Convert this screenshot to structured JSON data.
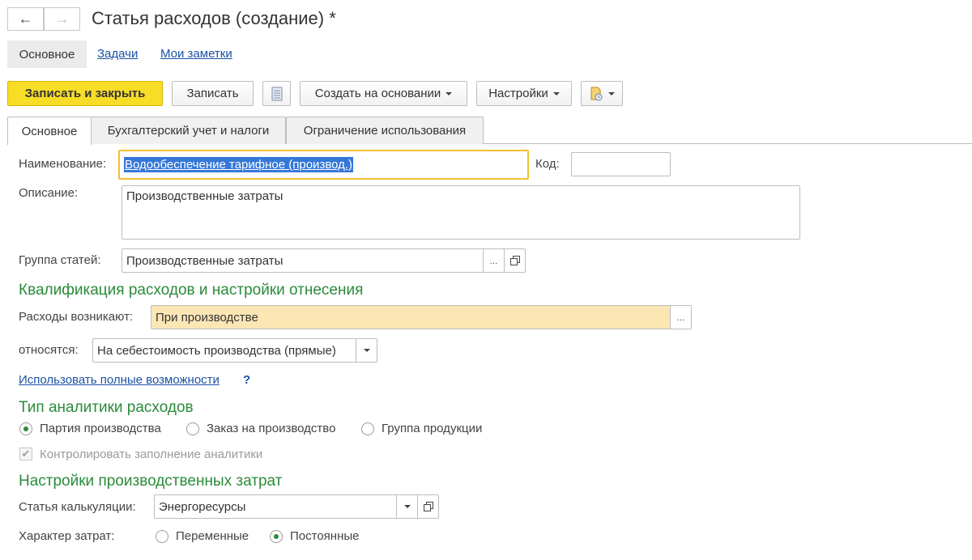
{
  "window": {
    "title": "Статья расходов (создание) *"
  },
  "nav": {
    "back_icon": "←",
    "forward_icon": "→"
  },
  "sections": {
    "active": "Основное",
    "links": [
      "Задачи",
      "Мои заметки"
    ]
  },
  "toolbar": {
    "save_close": "Записать и закрыть",
    "save": "Записать",
    "create_based": "Создать на основании",
    "settings": "Настройки"
  },
  "tabs": [
    "Основное",
    "Бухгалтерский учет и налоги",
    "Ограничение использования"
  ],
  "form": {
    "name_label": "Наименование:",
    "name_value": "Водообеспечение тарифное (производ.)",
    "code_label": "Код:",
    "code_value": "",
    "description_label": "Описание:",
    "description_value": "Производственные затраты",
    "group_label": "Группа статей:",
    "group_value": "Производственные затраты",
    "ellipsis": "...",
    "qualification_title": "Квалификация расходов и настройки отнесения",
    "arise_label": "Расходы возникают:",
    "arise_value": "При производстве",
    "relate_label": "относятся:",
    "relate_value": "На себестоимость производства (прямые)",
    "full_features_link": "Использовать полные возможности",
    "help": "?",
    "analytics_title": "Тип аналитики расходов",
    "analytics_options": [
      "Партия производства",
      "Заказ на производство",
      "Группа продукции"
    ],
    "analytics_selected": 0,
    "control_label": "Контролировать заполнение аналитики",
    "control_checked": true,
    "production_title": "Настройки производственных затрат",
    "calc_label": "Статья калькуляции:",
    "calc_value": "Энергоресурсы",
    "cost_nature_label": "Характер затрат:",
    "cost_nature_options": [
      "Переменные",
      "Постоянные"
    ],
    "cost_nature_selected": 1
  },
  "colors": {
    "accent_green": "#2a8b3a",
    "primary_yellow": "#f8dd27",
    "link_blue": "#1b52a3",
    "focus_yellow": "#f3c02c"
  }
}
